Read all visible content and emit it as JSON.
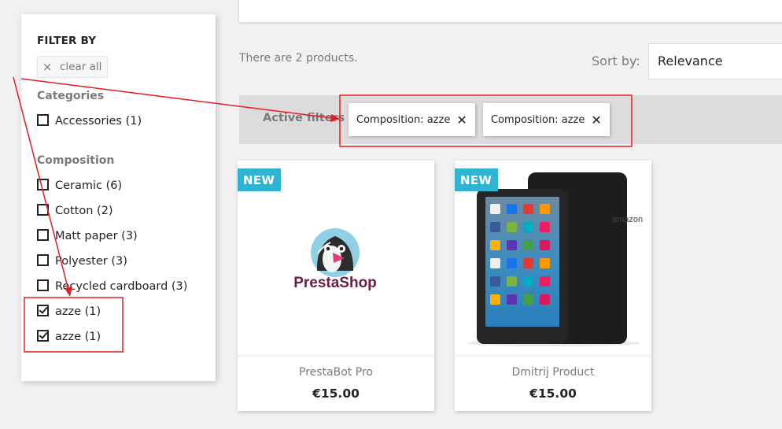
{
  "sidebar": {
    "title": "FILTER BY",
    "clear_all": "clear all",
    "facets": [
      {
        "title": "Categories",
        "items": [
          {
            "label": "Accessories (1)",
            "checked": false
          }
        ]
      },
      {
        "title": "Composition",
        "items": [
          {
            "label": "Ceramic (6)",
            "checked": false
          },
          {
            "label": "Cotton (2)",
            "checked": false
          },
          {
            "label": "Matt paper (3)",
            "checked": false
          },
          {
            "label": "Polyester (3)",
            "checked": false
          },
          {
            "label": "Recycled cardboard (3)",
            "checked": false
          },
          {
            "label": "azze (1)",
            "checked": true
          },
          {
            "label": "azze (1)",
            "checked": true
          }
        ]
      }
    ]
  },
  "products_header": {
    "count_text": "There are 2 products.",
    "sort_label": "Sort by:",
    "sort_value": "Relevance"
  },
  "active_filters": {
    "label": "Active filters",
    "chips": [
      {
        "label": "Composition: azze",
        "close": "✕"
      },
      {
        "label": "Composition: azze",
        "close": "✕"
      }
    ]
  },
  "products": [
    {
      "badge": "NEW",
      "name": "PrestaBot Pro",
      "price": "€15.00",
      "image": "prestashop-logo",
      "logo_text": "PrestaShop"
    },
    {
      "badge": "NEW",
      "name": "Dmitrij Product",
      "price": "€15.00",
      "image": "tablet"
    }
  ],
  "colors": {
    "accent": "#2fb5d2",
    "annotation": "#e02020",
    "logo_text": "#6b1b44",
    "logo_circle": "#8fd0e6"
  }
}
